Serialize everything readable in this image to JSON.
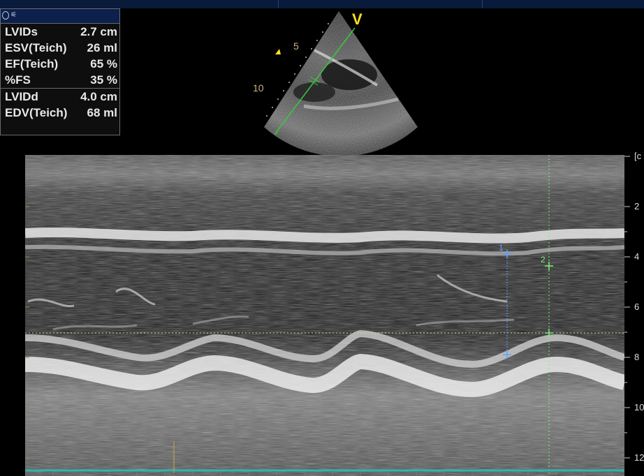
{
  "measurements": {
    "systolic": [
      {
        "label": "LVIDs",
        "value": "2.7 cm"
      },
      {
        "label": "ESV(Teich)",
        "value": "26 ml"
      },
      {
        "label": "EF(Teich)",
        "value": "65 %"
      },
      {
        "label": "%FS",
        "value": "35 %"
      }
    ],
    "diastolic": [
      {
        "label": "LVIDd",
        "value": "4.0 cm"
      },
      {
        "label": "EDV(Teich)",
        "value": "68 ml"
      }
    ]
  },
  "sector": {
    "orientation_marker": "V",
    "depth_marks": [
      "5",
      "10"
    ]
  },
  "depth_scale": {
    "unit_label": "[c",
    "ticks": [
      "2",
      "4",
      "6",
      "8",
      "10",
      "12"
    ]
  },
  "calipers": {
    "marker_1": "1",
    "marker_2": "2"
  },
  "colors": {
    "panel_header": "#0c1f4d",
    "caliper_1": "#5fa0ff",
    "caliper_2": "#7cf07c",
    "sector_marker": "#ffe01a",
    "timeline": "#2ab7b0"
  }
}
